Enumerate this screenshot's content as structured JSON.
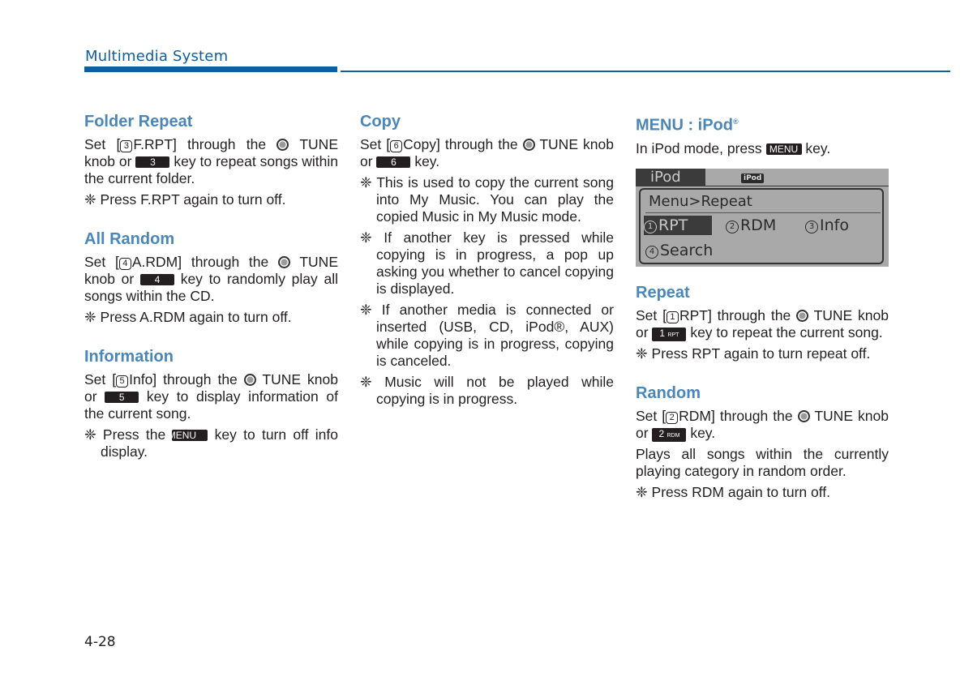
{
  "header": {
    "title": "Multimedia System",
    "accent_color": "#0d5f9f"
  },
  "column1": {
    "folder_repeat": {
      "title": "Folder Repeat",
      "set_prefix": "Set [",
      "menu_num": "3",
      "menu_label": "F.RPT] through the",
      "tune": "TUNE",
      "knob_or": "knob or",
      "key_label": "3",
      "after_key": "key to repeat songs within the current folder.",
      "note": "Press F.RPT again to turn off."
    },
    "all_random": {
      "title": "All Random",
      "set_prefix": "Set [",
      "menu_num": "4",
      "menu_label": "A.RDM] through the",
      "tune": "TUNE",
      "knob_or": "knob or",
      "key_label": "4",
      "after_key": "key to randomly play all songs within the CD.",
      "note": "Press A.RDM again to turn off."
    },
    "information": {
      "title": "Information",
      "set_prefix": "Set [",
      "menu_num": "5",
      "menu_label": "Info] through the",
      "tune": "TUNE",
      "knob_or": "knob or",
      "key_label": "5",
      "after_key": "key to display information of the current song.",
      "note_prefix": "Press the",
      "note_key": "MENU",
      "note_suffix": "key to turn off info display."
    }
  },
  "column2": {
    "copy": {
      "title": "Copy",
      "set_prefix": "Set [",
      "menu_num": "6",
      "menu_label": "Copy] through the",
      "tune": "TUNE",
      "knob_or": "knob or",
      "key_label": "6",
      "after_key": "key.",
      "notes": [
        "This is used to copy the current song into My Music. You can play the copied Music in My Music mode.",
        "If another key is pressed while copying is in progress, a pop up asking you whether to cancel copying is displayed.",
        "If another media is connected or inserted (USB, CD, iPod®, AUX) while copying is in progress, copying is canceled.",
        "Music will not be played while copying is in progress."
      ]
    }
  },
  "column3": {
    "menu_ipod": {
      "title": "MENU : iPod",
      "title_sup": "®",
      "intro_prefix": "In iPod mode, press",
      "intro_key": "MENU",
      "intro_suffix": "key."
    },
    "screen": {
      "tab": "iPod",
      "badge": "iPod",
      "breadcrumb": "Menu>Repeat",
      "options": [
        {
          "num": "1",
          "label": "RPT",
          "selected": true
        },
        {
          "num": "2",
          "label": "RDM",
          "selected": false
        },
        {
          "num": "3",
          "label": "Info",
          "selected": false
        },
        {
          "num": "4",
          "label": "Search",
          "selected": false
        }
      ]
    },
    "repeat": {
      "title": "Repeat",
      "set_prefix": "Set [",
      "menu_num": "1",
      "menu_label": "RPT] through the",
      "tune": "TUNE",
      "knob_or": "knob or",
      "key_num": "1",
      "key_small": "RPT",
      "after_key": "key to repeat the current song.",
      "note": "Press RPT again to turn repeat off."
    },
    "random": {
      "title": "Random",
      "set_prefix": "Set [",
      "menu_num": "2",
      "menu_label": "RDM] through the",
      "tune": "TUNE",
      "knob_or": "knob or",
      "key_num": "2",
      "key_small": "RDM",
      "after_key": "key.",
      "body": "Plays all songs within the currently playing category in random order.",
      "note": "Press RDM again to turn off."
    }
  },
  "note_symbol": "❈",
  "page_number": "4-28"
}
